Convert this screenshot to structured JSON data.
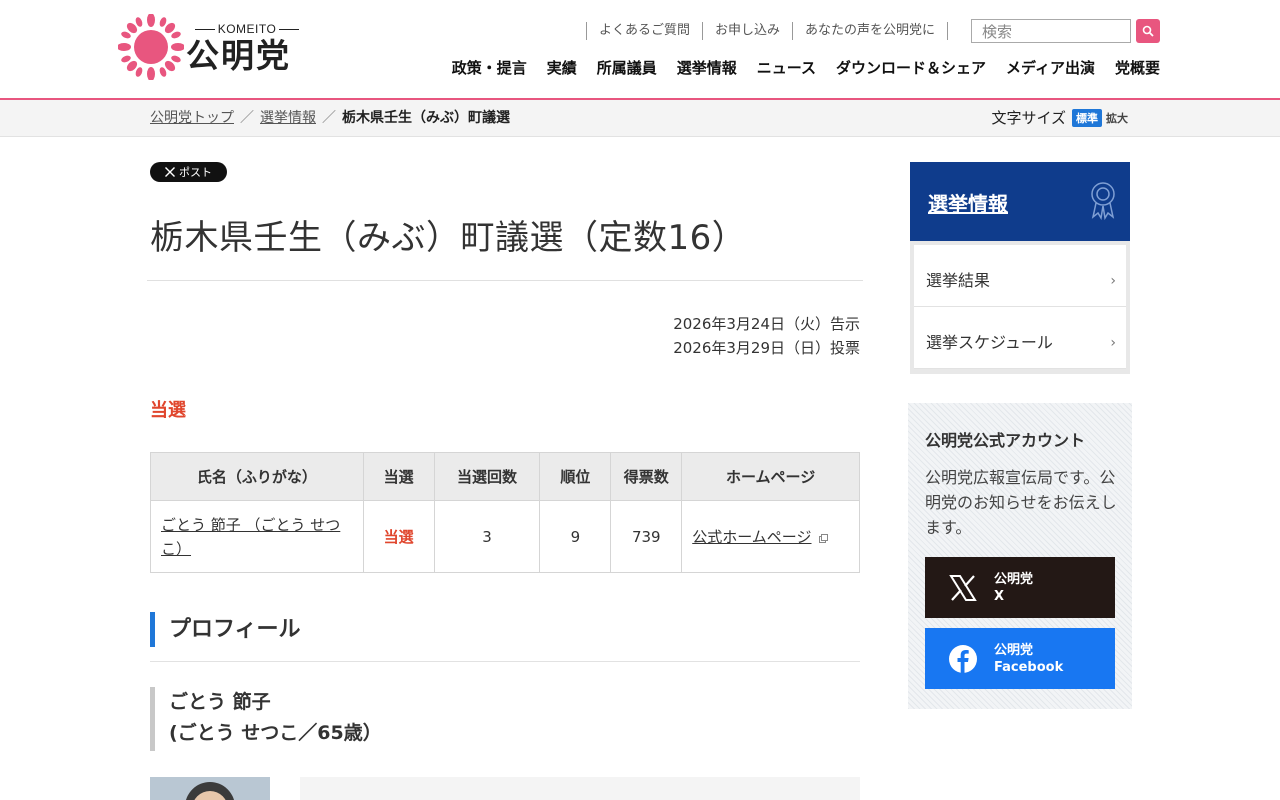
{
  "header": {
    "logo_en": "KOMEITO",
    "logo_ja": "公明党",
    "util_links": [
      "よくあるご質問",
      "お申し込み",
      "あなたの声を公明党に"
    ],
    "search_placeholder": "検索",
    "nav": [
      "政策・提言",
      "実績",
      "所属議員",
      "選挙情報",
      "ニュース",
      "ダウンロード＆シェア",
      "メディア出演",
      "党概要"
    ],
    "accent_color": "#e8567f"
  },
  "breadcrumb": {
    "items": [
      "公明党トップ",
      "選挙情報"
    ],
    "separator": "／",
    "current": "栃木県壬生（みぶ）町議選"
  },
  "font_size": {
    "label": "文字サイズ",
    "standard": "標準",
    "large": "拡大"
  },
  "main": {
    "post_button": "ポスト",
    "title": "栃木県壬生（みぶ）町議選（定数16）",
    "announce_date": "2026年3月24日（火）告示",
    "vote_date": "2026年3月29日（日）投票",
    "elected_heading": "当選",
    "table": {
      "headers": [
        "氏名（ふりがな）",
        "当選",
        "当選回数",
        "順位",
        "得票数",
        "ホームページ"
      ],
      "rows": [
        {
          "name": "ごとう 節子 （ごとう せつこ）",
          "result": "当選",
          "times": "3",
          "rank": "9",
          "votes": "739",
          "homepage": "公式ホームページ"
        }
      ]
    },
    "profile_heading": "プロフィール",
    "person_name": "ごとう 節子",
    "person_reading": "(ごとう せつこ／65歳）"
  },
  "sidebar": {
    "heading": "選挙情報",
    "heading_color": "#0f3c8c",
    "menu": [
      "選挙結果",
      "選挙スケジュール"
    ],
    "account_title": "公明党公式アカウント",
    "account_desc": "公明党広報宣伝局です。公明党のお知らせをお伝えします。",
    "sns_x": {
      "line1": "公明党",
      "line2": "X",
      "icon": "x-logo-icon"
    },
    "sns_fb": {
      "line1": "公明党",
      "line2": "Facebook",
      "icon": "facebook-logo-icon"
    }
  }
}
